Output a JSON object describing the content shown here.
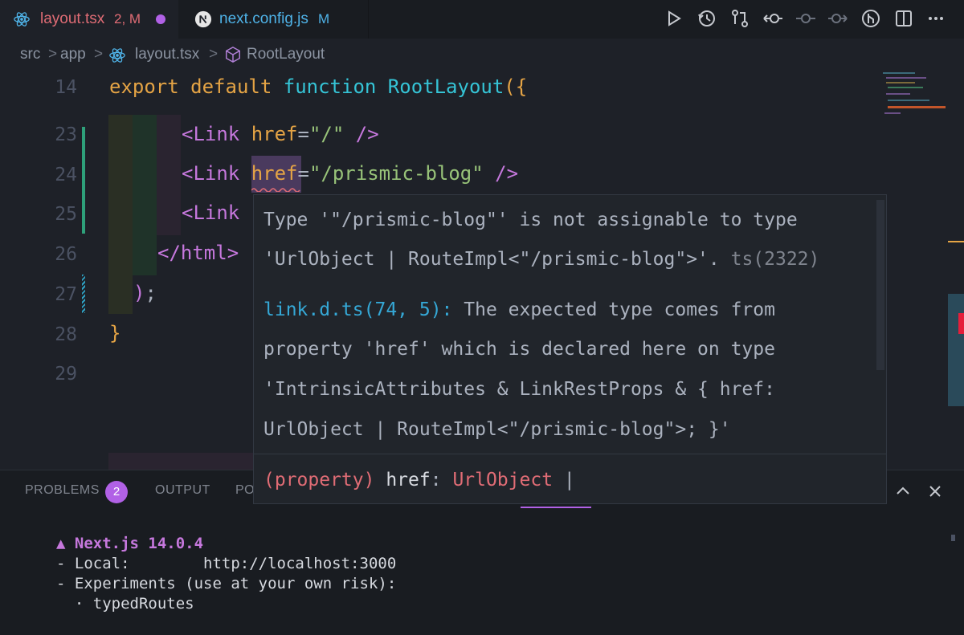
{
  "tabs": [
    {
      "label": "layout.tsx",
      "status": "2, M",
      "modified": true,
      "icon": "react-icon",
      "active": true
    },
    {
      "label": "next.config.js",
      "status": "M",
      "icon": "nextjs-icon",
      "active": false
    }
  ],
  "toolbar_icons": [
    "run-icon",
    "history-icon",
    "compare-changes-icon",
    "go-back-icon",
    "commit-icon",
    "go-forward-icon",
    "gitlens-icon",
    "split-editor-icon",
    "more-actions-icon"
  ],
  "breadcrumb": {
    "parts": [
      "src",
      "app",
      "layout.tsx",
      "RootLayout"
    ],
    "separator": ">"
  },
  "editor": {
    "lines": [
      {
        "num": "14",
        "tokens": [
          [
            "export default ",
            "kw"
          ],
          [
            "function ",
            "fn-kw"
          ],
          [
            "RootLayout",
            "fn-name"
          ],
          [
            "({",
            "brace"
          ]
        ]
      },
      {
        "num": "23",
        "tokens": [
          [
            "<Link ",
            "tag"
          ],
          [
            "href",
            "attr"
          ],
          [
            "=",
            "plain"
          ],
          [
            "\"/\"",
            "str"
          ],
          [
            " />",
            "tag"
          ]
        ]
      },
      {
        "num": "24",
        "tokens": [
          [
            "<Link ",
            "tag"
          ],
          [
            "href",
            "attr"
          ],
          [
            "=",
            "plain"
          ],
          [
            "\"/prismic-blog\"",
            "str"
          ],
          [
            " />",
            "tag"
          ]
        ]
      },
      {
        "num": "25",
        "tokens": [
          [
            "<Link",
            "tag"
          ]
        ]
      },
      {
        "num": "26",
        "tokens": [
          [
            "</html>",
            "tag"
          ]
        ]
      },
      {
        "num": "27",
        "tokens": [
          [
            ")",
            "paren"
          ],
          [
            ";",
            "plain"
          ]
        ]
      },
      {
        "num": "28",
        "tokens": [
          [
            "}",
            "brace"
          ]
        ]
      },
      {
        "num": "29",
        "tokens": []
      }
    ]
  },
  "hover": {
    "line1": "Type '\"/prismic-blog\"' is not assignable to type",
    "line2": "'UrlObject | RouteImpl<\"/prismic-blog\">'.",
    "line2_code": "ts(2322)",
    "line3_link": "link.d.ts(74, 5):",
    "line3_rest": " The expected type comes from",
    "line4": "property 'href' which is declared here on type",
    "line5": "'IntrinsicAttributes & LinkRestProps & { href:",
    "line6": "UrlObject | RouteImpl<\"/prismic-blog\">; }'",
    "sig_open": "(property)",
    "sig_name": " href",
    "sig_colon": ": ",
    "sig_type": "UrlObject",
    "sig_pipe": " |"
  },
  "panel": {
    "tabs": [
      {
        "label": "PROBLEMS",
        "badge": "2"
      },
      {
        "label": "OUTPUT"
      },
      {
        "label": "PO"
      }
    ],
    "terminal": [
      {
        "prefix": "▲ ",
        "text": "Next.js 14.0.4",
        "style": "title"
      },
      {
        "prefix": "- ",
        "text": "Local:        http://localhost:3000",
        "style": "plain"
      },
      {
        "prefix": "- ",
        "text": "Experiments (use at your own risk):",
        "style": "plain"
      },
      {
        "prefix": "  · ",
        "text": "typedRoutes",
        "style": "plain"
      }
    ]
  },
  "colors": {
    "keyword": "#e5a445",
    "function": "#35c4d6",
    "tag": "#c678dd",
    "attr": "#e5a445",
    "string": "#98c379",
    "error": "#e06c75",
    "accent": "#b161e6"
  }
}
